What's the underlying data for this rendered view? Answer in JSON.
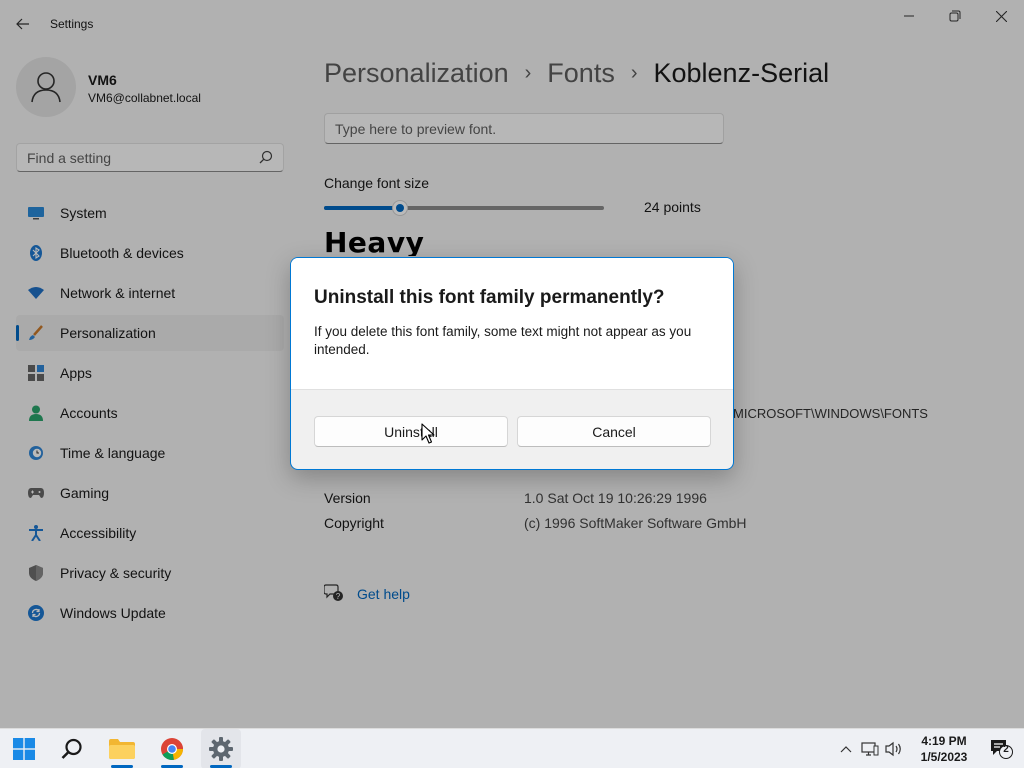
{
  "window": {
    "title": "Settings"
  },
  "user": {
    "name": "VM6",
    "email": "VM6@collabnet.local"
  },
  "search": {
    "placeholder": "Find a setting"
  },
  "sidebar": {
    "items": [
      {
        "label": "System",
        "icon": "system-icon",
        "active": false
      },
      {
        "label": "Bluetooth & devices",
        "icon": "bluetooth-icon",
        "active": false
      },
      {
        "label": "Network & internet",
        "icon": "wifi-icon",
        "active": false
      },
      {
        "label": "Personalization",
        "icon": "brush-icon",
        "active": true
      },
      {
        "label": "Apps",
        "icon": "apps-icon",
        "active": false
      },
      {
        "label": "Accounts",
        "icon": "accounts-icon",
        "active": false
      },
      {
        "label": "Time & language",
        "icon": "clock-globe-icon",
        "active": false
      },
      {
        "label": "Gaming",
        "icon": "gamepad-icon",
        "active": false
      },
      {
        "label": "Accessibility",
        "icon": "accessibility-icon",
        "active": false
      },
      {
        "label": "Privacy & security",
        "icon": "shield-icon",
        "active": false
      },
      {
        "label": "Windows Update",
        "icon": "update-icon",
        "active": false
      }
    ]
  },
  "breadcrumb": {
    "items": [
      "Personalization",
      "Fonts"
    ],
    "separator": "›",
    "current": "Koblenz-Serial"
  },
  "preview": {
    "placeholder": "Type here to preview font."
  },
  "font_size": {
    "label": "Change font size",
    "value_text": "24 points",
    "fraction": 0.27
  },
  "sample": {
    "text": "Heavy"
  },
  "metadata": {
    "path_fragment": "MICROSOFT\\WINDOWS\\FONTS",
    "rows": [
      {
        "key": "Version",
        "value": "1.0 Sat Oct 19 10:26:29 1996"
      },
      {
        "key": "Copyright",
        "value": "(c) 1996 SoftMaker Software GmbH"
      }
    ]
  },
  "help": {
    "label": "Get help"
  },
  "dialog": {
    "title": "Uninstall this font family permanently?",
    "message": "If you delete this font family, some text might not appear as you intended.",
    "primary_label": "Uninstall",
    "secondary_label": "Cancel"
  },
  "taskbar": {
    "time": "4:19 PM",
    "date": "1/5/2023",
    "notification_count": "2"
  },
  "colors": {
    "accent": "#0067c0",
    "dialog_border": "#0078d4"
  }
}
